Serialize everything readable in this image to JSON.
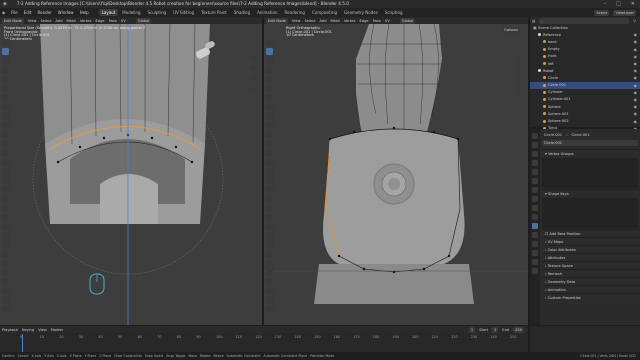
{
  "app": {
    "title": "7-2 Adding Reference Images [C:\\Users\\Yiqi\\Desktop\\Blender 4.5 Robot creation for beginners\\source files\\7-2 Adding Reference Images\\blend] - Blender 4.5.0"
  },
  "menu": [
    "File",
    "Edit",
    "Render",
    "Window",
    "Help"
  ],
  "workspaces": [
    "Layout",
    "Modeling",
    "Sculpting",
    "UV Editing",
    "Texture Paint",
    "Shading",
    "Animation",
    "Rendering",
    "Compositing",
    "Geometry Nodes",
    "Scripting"
  ],
  "active_workspace": "Layout",
  "topright": {
    "scene": "Scene",
    "viewlayer": "ViewLayer"
  },
  "left_view": {
    "header": [
      "Edit Mode",
      "View",
      "Select",
      "Add",
      "Mesh",
      "Vertex",
      "Edge",
      "Face",
      "UV"
    ],
    "transform": "Global",
    "overlay": [
      "Proportional Size (Smooth): 0.4239 m · D: 0.3708 m (0.3708 m) along global Z",
      "Front Orthographic",
      "(1) Circle.001 | Circle.001",
      "10 Centimeters"
    ]
  },
  "right_view": {
    "header": [
      "Edit Mode",
      "View",
      "Select",
      "Add",
      "Mesh",
      "Vertex",
      "Edge",
      "Face",
      "UV"
    ],
    "transform": "Global",
    "options": "Options",
    "overlay": [
      "Right Orthographic",
      "(1) Circle.001 | Circle.001",
      "10 Centimeters"
    ]
  },
  "outliner": {
    "title": "Scene Collection",
    "rows": [
      {
        "label": "Reference",
        "depth": 1,
        "color": "#d8d8d8",
        "sel": false
      },
      {
        "label": "back",
        "depth": 2,
        "color": "#c9a14a",
        "sel": false
      },
      {
        "label": "Empty",
        "depth": 2,
        "color": "#c9a14a",
        "sel": false
      },
      {
        "label": "front",
        "depth": 2,
        "color": "#c9a14a",
        "sel": false
      },
      {
        "label": "left",
        "depth": 2,
        "color": "#c9a14a",
        "sel": false
      },
      {
        "label": "Robot",
        "depth": 1,
        "color": "#d8d8d8",
        "sel": false
      },
      {
        "label": "Circle",
        "depth": 2,
        "color": "#e89a3c",
        "sel": false
      },
      {
        "label": "Circle.001",
        "depth": 2,
        "color": "#e89a3c",
        "sel": true
      },
      {
        "label": "Cylinder",
        "depth": 2,
        "color": "#e89a3c",
        "sel": false
      },
      {
        "label": "Cylinder.001",
        "depth": 2,
        "color": "#e89a3c",
        "sel": false
      },
      {
        "label": "Sphere",
        "depth": 2,
        "color": "#e89a3c",
        "sel": false
      },
      {
        "label": "Sphere.001",
        "depth": 2,
        "color": "#e89a3c",
        "sel": false
      },
      {
        "label": "Sphere.002",
        "depth": 2,
        "color": "#e89a3c",
        "sel": false
      },
      {
        "label": "Torus",
        "depth": 2,
        "color": "#e89a3c",
        "sel": false
      }
    ]
  },
  "properties": {
    "object": "Circle.001",
    "data": "Circle.001",
    "field": "Circle.001",
    "sections": [
      "Vertex Groups",
      "Shape Keys",
      "Add Rest Position",
      "UV Maps",
      "Color Attributes",
      "Attributes",
      "Texture Space",
      "Remesh",
      "Geometry Data",
      "Animation",
      "Custom Properties"
    ]
  },
  "timeline": {
    "menus": [
      "Playback",
      "Keying",
      "View",
      "Marker"
    ],
    "start_label": "Start",
    "start": "1",
    "end_label": "End",
    "end": "250",
    "current": "1",
    "ticks": [
      "0",
      "10",
      "20",
      "30",
      "40",
      "50",
      "60",
      "70",
      "80",
      "90",
      "100",
      "110",
      "120",
      "130",
      "140",
      "150",
      "160",
      "170",
      "180",
      "190",
      "200",
      "210",
      "220",
      "230",
      "240",
      "250"
    ]
  },
  "statusbar": {
    "items": [
      "Confirm",
      "Cancel",
      "X Axis",
      "Y Axis",
      "Z Axis",
      "X Plane",
      "Y Plane",
      "Z Plane",
      "Clear Constraints",
      "Snap Invert",
      "Snap Toggle",
      "Move",
      "Rotate",
      "Resize",
      "Automatic Constraint",
      "Automatic Constraint Plane",
      "Precision Mode"
    ],
    "right": "Circle.001 | Verts 2/64 | Faces 0/32"
  },
  "colors": {
    "accent": "#4d6fa3",
    "selection": "#e89a3c",
    "active_tab": "#3d3d3d"
  }
}
